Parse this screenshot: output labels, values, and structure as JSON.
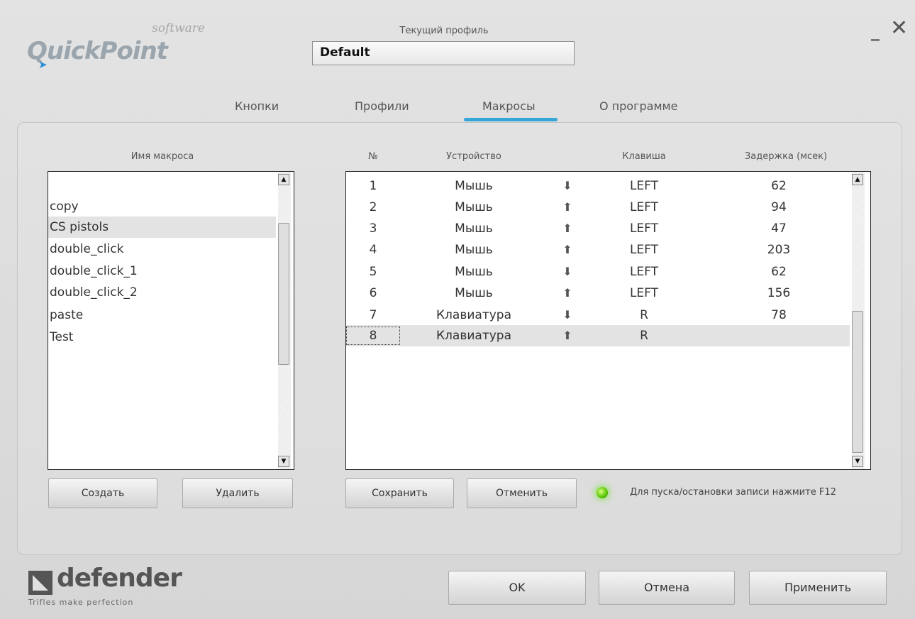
{
  "app": {
    "logo_name": "QuickPoint",
    "logo_suffix": "software",
    "window": {
      "minimize_glyph": "_",
      "close_glyph": "✕"
    }
  },
  "profile": {
    "label": "Текущий профиль",
    "value": "Default"
  },
  "tabs": [
    {
      "label": "Кнопки",
      "active": false
    },
    {
      "label": "Профили",
      "active": false
    },
    {
      "label": "Макросы",
      "active": true
    },
    {
      "label": "О программе",
      "active": false
    }
  ],
  "macros": {
    "header": "Имя макроса",
    "items": [
      "",
      "copy",
      "CS pistols",
      "double_click",
      "double_click_1",
      "double_click_2",
      "paste",
      "Test"
    ],
    "selected_index": 2,
    "create_label": "Создать",
    "delete_label": "Удалить"
  },
  "steps": {
    "headers": {
      "num": "№",
      "device": "Устройство",
      "key": "Клавиша",
      "delay": "Задержка (мсек)"
    },
    "rows": [
      {
        "num": "1",
        "device": "Мышь",
        "direction": "down",
        "key": "LEFT",
        "delay": "62"
      },
      {
        "num": "2",
        "device": "Мышь",
        "direction": "up",
        "key": "LEFT",
        "delay": "94"
      },
      {
        "num": "3",
        "device": "Мышь",
        "direction": "up",
        "key": "LEFT",
        "delay": "47"
      },
      {
        "num": "4",
        "device": "Мышь",
        "direction": "up",
        "key": "LEFT",
        "delay": "203"
      },
      {
        "num": "5",
        "device": "Мышь",
        "direction": "down",
        "key": "LEFT",
        "delay": "62"
      },
      {
        "num": "6",
        "device": "Мышь",
        "direction": "up",
        "key": "LEFT",
        "delay": "156"
      },
      {
        "num": "7",
        "device": "Клавиатура",
        "direction": "down",
        "key": "R",
        "delay": "78"
      },
      {
        "num": "8",
        "device": "Клавиатура",
        "direction": "up",
        "key": "R",
        "delay": ""
      }
    ],
    "selected_index": 7,
    "save_label": "Сохранить",
    "cancel_label": "Отменить",
    "record_hint": "Для пуска/остановки записи нажмите F12",
    "led_color": "#54c400"
  },
  "footer": {
    "brand": "defender",
    "tagline": "Trifles make perfection",
    "ok_label": "OK",
    "cancel_label": "Отмена",
    "apply_label": "Применить"
  },
  "icons": {
    "arrow_down": "down-arrow-icon",
    "arrow_up": "up-arrow-icon",
    "scroll_up": "scroll-up-icon",
    "scroll_down": "scroll-down-icon"
  },
  "colors": {
    "accent": "#36a6d8",
    "background": "#d9d9d9"
  }
}
